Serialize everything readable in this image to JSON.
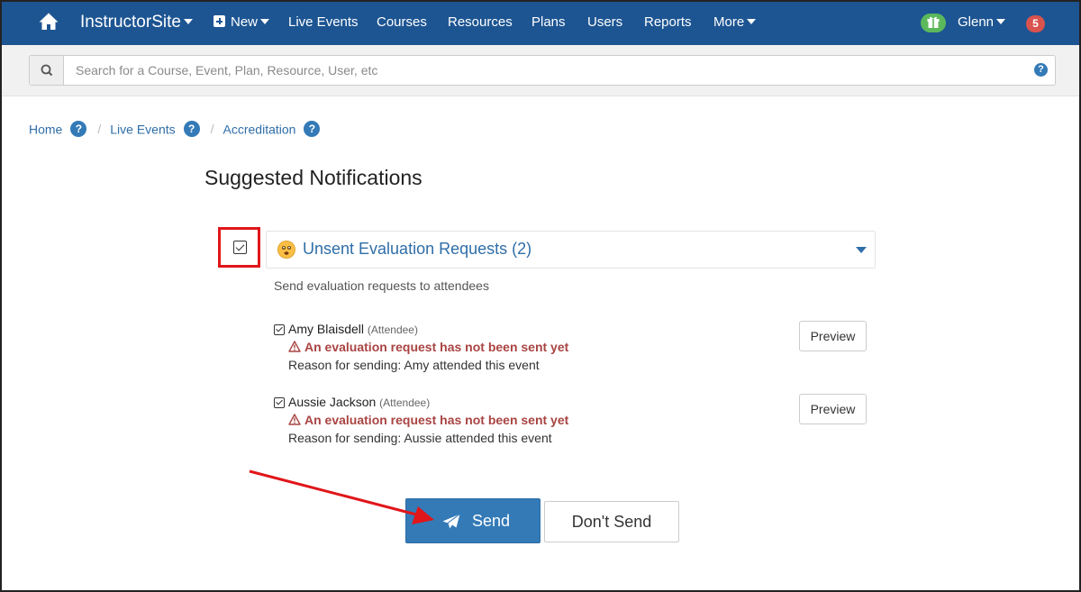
{
  "nav": {
    "brand": "InstructorSite",
    "new_label": "New",
    "items": [
      "Live Events",
      "Courses",
      "Resources",
      "Plans",
      "Users",
      "Reports"
    ],
    "more_label": "More",
    "user_name": "Glenn",
    "notification_count": "5"
  },
  "search": {
    "placeholder": "Search for a Course, Event, Plan, Resource, User, etc",
    "help": "?"
  },
  "breadcrumb": {
    "items": [
      "Home",
      "Live Events",
      "Accreditation"
    ],
    "separator": "/",
    "help": "?"
  },
  "page": {
    "title": "Suggested Notifications"
  },
  "panel": {
    "title": "Unsent Evaluation Requests (2)",
    "description": "Send evaluation requests to attendees"
  },
  "attendees": [
    {
      "name": "Amy Blaisdell",
      "role": "(Attendee)",
      "warning": "An evaluation request has not been sent yet",
      "reason": "Reason for sending: Amy attended this event",
      "preview_label": "Preview"
    },
    {
      "name": "Aussie Jackson",
      "role": "(Attendee)",
      "warning": "An evaluation request has not been sent yet",
      "reason": "Reason for sending: Aussie attended this event",
      "preview_label": "Preview"
    }
  ],
  "actions": {
    "send_label": "Send",
    "dont_send_label": "Don't Send"
  },
  "colors": {
    "navbar": "#1d5592",
    "link": "#2f6ea8",
    "primary": "#337ab7",
    "warning_text": "#a94442",
    "annotation": "#e0161a",
    "gift": "#5cb85c",
    "badge": "#d9534f"
  }
}
